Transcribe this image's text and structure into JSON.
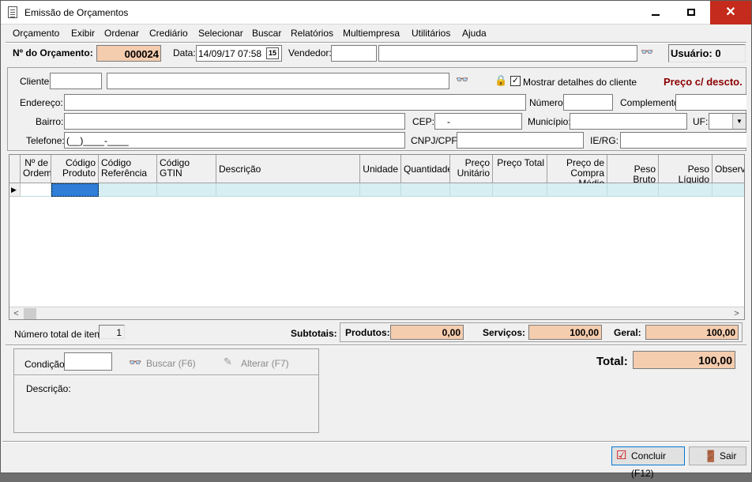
{
  "window": {
    "title": "Emissão de Orçamentos"
  },
  "menu": [
    {
      "label": "Orçamento"
    },
    {
      "label": "Exibir"
    },
    {
      "label": "Ordenar"
    },
    {
      "label": "Crediário"
    },
    {
      "label": "Selecionar"
    },
    {
      "label": "Buscar"
    },
    {
      "label": "Relatórios"
    },
    {
      "label": "Multiempresa"
    },
    {
      "label": "Utilitários"
    },
    {
      "label": "Ajuda"
    }
  ],
  "header": {
    "orcamento_label": "Nº do Orçamento:",
    "orcamento_value": "000024",
    "data_label": "Data:",
    "data_value": "14/09/17 07:58",
    "calendar_glyph": "15",
    "vendedor_label": "Vendedor:",
    "vendedor_code": "",
    "vendedor_name": "",
    "usuario_label": "Usuário: 0"
  },
  "cliente": {
    "cliente_label": "Cliente:",
    "cliente_code": "",
    "cliente_name": "",
    "mostrar_detalhes_label": "Mostrar detalhes do cliente",
    "mostrar_detalhes_checked": true,
    "preco_label": "Preço c/ descto.",
    "endereco_label": "Endereço:",
    "numero_label": "Número:",
    "complemento_label": "Complemento:",
    "bairro_label": "Bairro:",
    "cep_label": "CEP:",
    "cep_value": "-",
    "municipio_label": "Município:",
    "uf_label": "UF:",
    "telefone_label": "Telefone:",
    "telefone_value": "(__)____-____",
    "cnpj_label": "CNPJ/CPF:",
    "ie_label": "IE/RG:"
  },
  "grid": {
    "columns": [
      {
        "label": "Nº de Ordem"
      },
      {
        "label": "Código Produto"
      },
      {
        "label": "Código Referência"
      },
      {
        "label": "Código GTIN"
      },
      {
        "label": "Descrição"
      },
      {
        "label": "Unidade"
      },
      {
        "label": "Quantidade"
      },
      {
        "label": "Preço Unitário"
      },
      {
        "label": "Preço Total"
      },
      {
        "label": "Preço de Compra Médio"
      },
      {
        "label": "Peso Bruto"
      },
      {
        "label": "Peso Líquido"
      },
      {
        "label": "Observa"
      }
    ]
  },
  "totals": {
    "num_itens_label": "Número total de itens:",
    "num_itens_value": "1",
    "subtotais_label": "Subtotais:",
    "produtos_label": "Produtos:",
    "produtos_value": "0,00",
    "servicos_label": "Serviços:",
    "servicos_value": "100,00",
    "geral_label": "Geral:",
    "geral_value": "100,00",
    "total_label": "Total:",
    "total_value": "100,00"
  },
  "condicao": {
    "condicao_label": "Condição:",
    "condicao_value": "",
    "buscar_label": "Buscar (F6)",
    "alterar_label": "Alterar (F7)",
    "descricao_label": "Descrição:"
  },
  "footer": {
    "concluir_label": "Concluir (F12)",
    "sair_label": "Sair"
  }
}
